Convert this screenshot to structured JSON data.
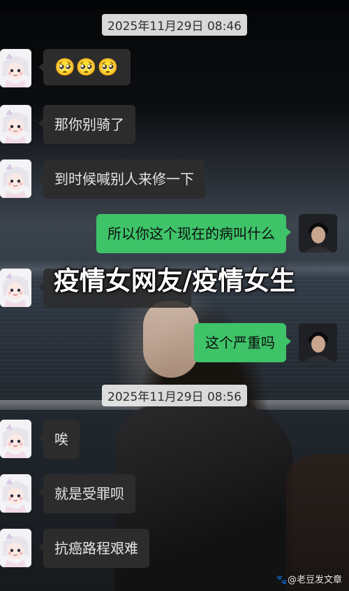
{
  "timestamps": {
    "first": "2025年11月29日 08:46",
    "second": "2025年11月29日 08:56"
  },
  "messages": [
    {
      "side": "left",
      "text": "🥺🥺🥺"
    },
    {
      "side": "left",
      "text": "那你别骑了"
    },
    {
      "side": "left",
      "text": "到时候喊别人来修一下"
    },
    {
      "side": "right",
      "text": "所以你这个现在的病叫什么"
    },
    {
      "side": "left",
      "text": ""
    },
    {
      "side": "right",
      "text": "这个严重吗"
    },
    {
      "side": "left",
      "text": "唉"
    },
    {
      "side": "left",
      "text": "就是受罪呗"
    },
    {
      "side": "left",
      "text": "抗癌路程艰难"
    }
  ],
  "overlay": {
    "title": "疫情女网友/疫情女生"
  },
  "watermark": "🐾@老豆发文章",
  "colors": {
    "incoming_bubble": "#2c2c2c",
    "outgoing_bubble": "#3ec369",
    "timestamp_bg": "#ececec"
  },
  "icons": {
    "left_avatar": "cartoon-girl-avatar",
    "right_avatar": "man-photo-avatar"
  }
}
